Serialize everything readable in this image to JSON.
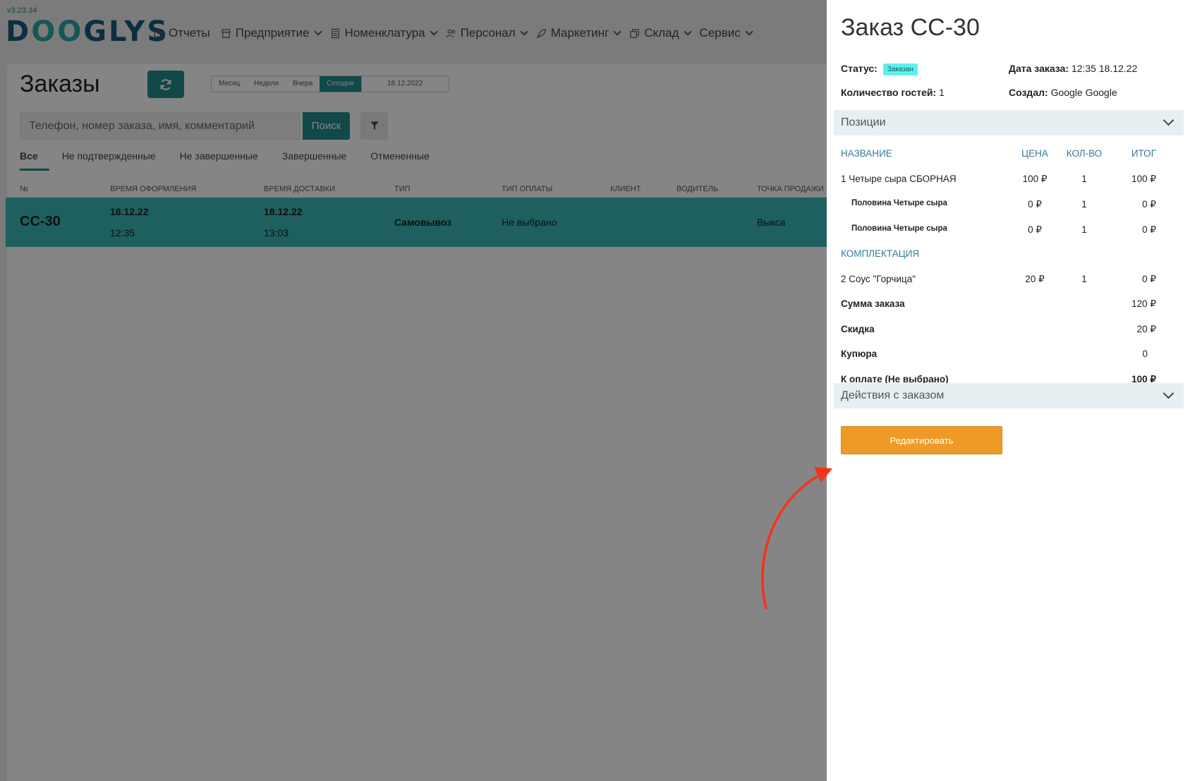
{
  "app": {
    "version": "v3.23.34",
    "logo": "DOOGLYS",
    "nav": [
      {
        "label": "Отчеты",
        "icon": "mail-icon",
        "dropdown": false
      },
      {
        "label": "Предприятие",
        "icon": "store-icon",
        "dropdown": true
      },
      {
        "label": "Номенклатура",
        "icon": "document-icon",
        "dropdown": true
      },
      {
        "label": "Персонал",
        "icon": "people-icon",
        "dropdown": true
      },
      {
        "label": "Маркетинг",
        "icon": "rocket-icon",
        "dropdown": true
      },
      {
        "label": "Склад",
        "icon": "boxes-icon",
        "dropdown": true
      },
      {
        "label": "Сервис",
        "icon": "",
        "dropdown": true
      }
    ]
  },
  "orders_page": {
    "title": "Заказы",
    "period": {
      "options": [
        "Месяц",
        "Неделя",
        "Вчера",
        "Сегодня"
      ],
      "active": "Сегодня",
      "date": "18.12.2022"
    },
    "search": {
      "placeholder": "Телефон, номер заказа, имя, комментарий",
      "button": "Поиск"
    },
    "tabs": [
      "Все",
      "Не подтвержденные",
      "Не завершенные",
      "Завершенные",
      "Отмененные"
    ],
    "active_tab": "Все",
    "columns": [
      "№",
      "ВРЕМЯ ОФОРМЛЕНИЯ",
      "ВРЕМЯ ДОСТАВКИ",
      "ТИП",
      "ТИП ОПЛАТЫ",
      "КЛИЕНТ",
      "ВОДИТЕЛЬ",
      "ТОЧКА ПРОДАЖИ"
    ],
    "orders": [
      {
        "number": "CC-30",
        "created_date": "18.12.22",
        "created_time": "12:35",
        "delivery_date": "18.12.22",
        "delivery_time": "13:03",
        "type": "Самовывоз",
        "payment": "Не выбрано",
        "client": "",
        "driver": "",
        "point": "Выкса"
      }
    ],
    "highlight_color": "#3bb8b6"
  },
  "order_panel": {
    "title": "Заказ CC-30",
    "status_label": "Статус:",
    "status_value": "Заказан",
    "date_label": "Дата заказа:",
    "date_value": "12:35 18.12.22",
    "guests_label": "Количество гостей:",
    "guests_value": "1",
    "creator_label": "Создал:",
    "creator_value": "Google Google",
    "positions_header": "Позиции",
    "columns": {
      "name": "НАЗВАНИЕ",
      "price": "ЦЕНА",
      "qty": "КОЛ-ВО",
      "total": "ИТОГ"
    },
    "items": [
      {
        "name": "1 Четыре сыра СБОРНАЯ",
        "price": "100 ₽",
        "qty": "1",
        "total": "100 ₽"
      },
      {
        "name": "Половина Четыре сыра",
        "price": "0 ₽",
        "qty": "1",
        "total": "0 ₽"
      },
      {
        "name": "Половина Четыре сыра",
        "price": "0 ₽",
        "qty": "1",
        "total": "0 ₽"
      }
    ],
    "group_label": "КОМПЛЕКТАЦИЯ",
    "extras": [
      {
        "name": "2 Соус \"Горчица\"",
        "price": "20 ₽",
        "qty": "1",
        "total": "0 ₽"
      }
    ],
    "summary": {
      "sum_label": "Сумма заказа",
      "sum_value": "120 ₽",
      "discount_label": "Скидка",
      "discount_value": "20 ₽",
      "banknote_label": "Купюра",
      "banknote_value": "0",
      "pay_label": "К оплате (Не выбрано)",
      "pay_value": "100 ₽"
    },
    "actions_header": "Действия с заказом",
    "edit_button": "Редактировать",
    "accent_color": "#ee9a26"
  },
  "annotation": {
    "arrow_color": "#f4321b"
  }
}
